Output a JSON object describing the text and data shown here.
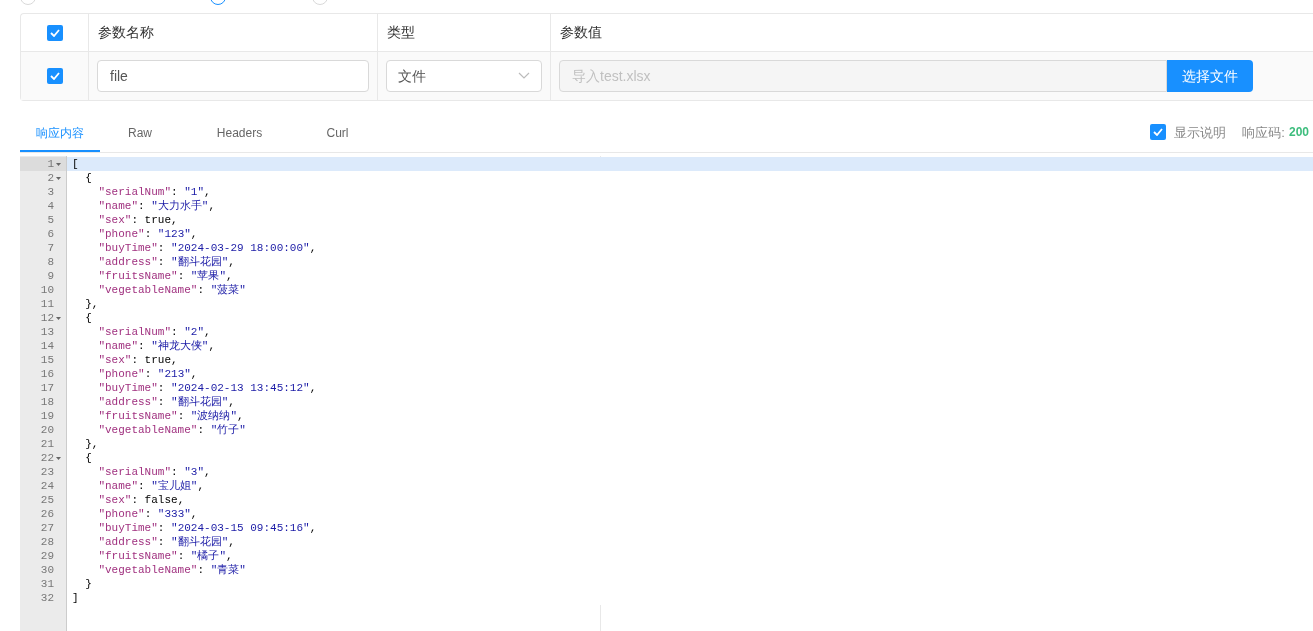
{
  "radios": [
    {
      "selected": false
    },
    {
      "selected": true
    },
    {
      "selected": false
    }
  ],
  "params_table": {
    "header_checked": true,
    "columns": [
      "参数名称",
      "类型",
      "参数值"
    ],
    "rows": [
      {
        "checked": true,
        "name": "file",
        "type": "文件",
        "value_placeholder": "导入test.xlsx",
        "button": "选择文件"
      }
    ]
  },
  "response_tabs": [
    {
      "label": "响应内容",
      "selected": true
    },
    {
      "label": "Raw",
      "selected": false
    },
    {
      "label": "Headers",
      "selected": false
    },
    {
      "label": "Curl",
      "selected": false
    }
  ],
  "show_description": {
    "label": "显示说明",
    "checked": true
  },
  "status": {
    "label": "响应码:",
    "code": "200"
  },
  "editor": {
    "lines": [
      {
        "number": "1",
        "foldable": true,
        "active": true,
        "text": "["
      },
      {
        "number": "2",
        "foldable": true,
        "active": false,
        "text": "  {"
      },
      {
        "number": "3",
        "foldable": false,
        "active": false,
        "text": "    \"serialNum\": \"1\","
      },
      {
        "number": "4",
        "foldable": false,
        "active": false,
        "text": "    \"name\": \"大力水手\","
      },
      {
        "number": "5",
        "foldable": false,
        "active": false,
        "text": "    \"sex\": true,"
      },
      {
        "number": "6",
        "foldable": false,
        "active": false,
        "text": "    \"phone\": \"123\","
      },
      {
        "number": "7",
        "foldable": false,
        "active": false,
        "text": "    \"buyTime\": \"2024-03-29 18:00:00\","
      },
      {
        "number": "8",
        "foldable": false,
        "active": false,
        "text": "    \"address\": \"翻斗花园\","
      },
      {
        "number": "9",
        "foldable": false,
        "active": false,
        "text": "    \"fruitsName\": \"苹果\","
      },
      {
        "number": "10",
        "foldable": false,
        "active": false,
        "text": "    \"vegetableName\": \"菠菜\""
      },
      {
        "number": "11",
        "foldable": false,
        "active": false,
        "text": "  },"
      },
      {
        "number": "12",
        "foldable": true,
        "active": false,
        "text": "  {"
      },
      {
        "number": "13",
        "foldable": false,
        "active": false,
        "text": "    \"serialNum\": \"2\","
      },
      {
        "number": "14",
        "foldable": false,
        "active": false,
        "text": "    \"name\": \"神龙大侠\","
      },
      {
        "number": "15",
        "foldable": false,
        "active": false,
        "text": "    \"sex\": true,"
      },
      {
        "number": "16",
        "foldable": false,
        "active": false,
        "text": "    \"phone\": \"213\","
      },
      {
        "number": "17",
        "foldable": false,
        "active": false,
        "text": "    \"buyTime\": \"2024-02-13 13:45:12\","
      },
      {
        "number": "18",
        "foldable": false,
        "active": false,
        "text": "    \"address\": \"翻斗花园\","
      },
      {
        "number": "19",
        "foldable": false,
        "active": false,
        "text": "    \"fruitsName\": \"波纳纳\","
      },
      {
        "number": "20",
        "foldable": false,
        "active": false,
        "text": "    \"vegetableName\": \"竹子\""
      },
      {
        "number": "21",
        "foldable": false,
        "active": false,
        "text": "  },"
      },
      {
        "number": "22",
        "foldable": true,
        "active": false,
        "text": "  {"
      },
      {
        "number": "23",
        "foldable": false,
        "active": false,
        "text": "    \"serialNum\": \"3\","
      },
      {
        "number": "24",
        "foldable": false,
        "active": false,
        "text": "    \"name\": \"宝儿姐\","
      },
      {
        "number": "25",
        "foldable": false,
        "active": false,
        "text": "    \"sex\": false,"
      },
      {
        "number": "26",
        "foldable": false,
        "active": false,
        "text": "    \"phone\": \"333\","
      },
      {
        "number": "27",
        "foldable": false,
        "active": false,
        "text": "    \"buyTime\": \"2024-03-15 09:45:16\","
      },
      {
        "number": "28",
        "foldable": false,
        "active": false,
        "text": "    \"address\": \"翻斗花园\","
      },
      {
        "number": "29",
        "foldable": false,
        "active": false,
        "text": "    \"fruitsName\": \"橘子\","
      },
      {
        "number": "30",
        "foldable": false,
        "active": false,
        "text": "    \"vegetableName\": \"青菜\""
      },
      {
        "number": "31",
        "foldable": false,
        "active": false,
        "text": "  }"
      },
      {
        "number": "32",
        "foldable": false,
        "active": false,
        "text": "]"
      }
    ]
  }
}
